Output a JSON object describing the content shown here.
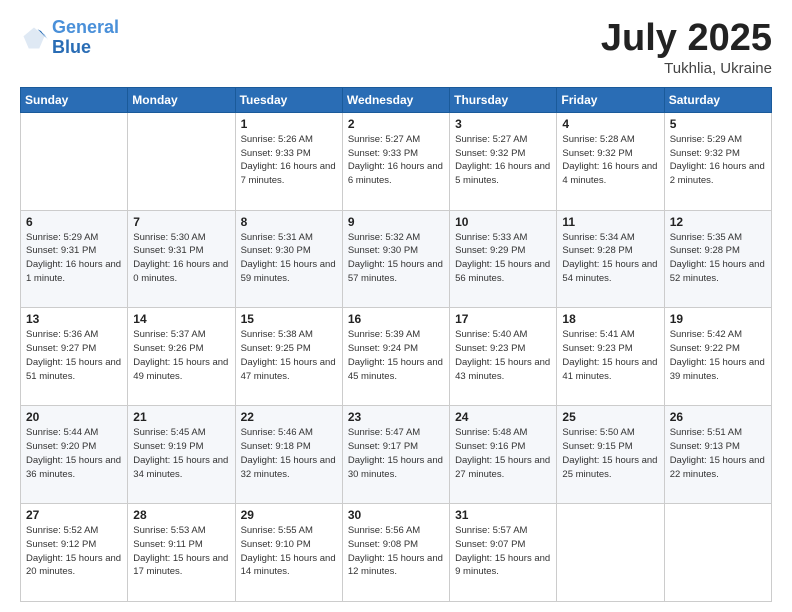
{
  "header": {
    "logo_line1": "General",
    "logo_line2": "Blue",
    "month": "July 2025",
    "location": "Tukhlia, Ukraine"
  },
  "weekdays": [
    "Sunday",
    "Monday",
    "Tuesday",
    "Wednesday",
    "Thursday",
    "Friday",
    "Saturday"
  ],
  "weeks": [
    [
      {
        "day": null
      },
      {
        "day": null
      },
      {
        "day": "1",
        "sunrise": "Sunrise: 5:26 AM",
        "sunset": "Sunset: 9:33 PM",
        "daylight": "Daylight: 16 hours and 7 minutes."
      },
      {
        "day": "2",
        "sunrise": "Sunrise: 5:27 AM",
        "sunset": "Sunset: 9:33 PM",
        "daylight": "Daylight: 16 hours and 6 minutes."
      },
      {
        "day": "3",
        "sunrise": "Sunrise: 5:27 AM",
        "sunset": "Sunset: 9:32 PM",
        "daylight": "Daylight: 16 hours and 5 minutes."
      },
      {
        "day": "4",
        "sunrise": "Sunrise: 5:28 AM",
        "sunset": "Sunset: 9:32 PM",
        "daylight": "Daylight: 16 hours and 4 minutes."
      },
      {
        "day": "5",
        "sunrise": "Sunrise: 5:29 AM",
        "sunset": "Sunset: 9:32 PM",
        "daylight": "Daylight: 16 hours and 2 minutes."
      }
    ],
    [
      {
        "day": "6",
        "sunrise": "Sunrise: 5:29 AM",
        "sunset": "Sunset: 9:31 PM",
        "daylight": "Daylight: 16 hours and 1 minute."
      },
      {
        "day": "7",
        "sunrise": "Sunrise: 5:30 AM",
        "sunset": "Sunset: 9:31 PM",
        "daylight": "Daylight: 16 hours and 0 minutes."
      },
      {
        "day": "8",
        "sunrise": "Sunrise: 5:31 AM",
        "sunset": "Sunset: 9:30 PM",
        "daylight": "Daylight: 15 hours and 59 minutes."
      },
      {
        "day": "9",
        "sunrise": "Sunrise: 5:32 AM",
        "sunset": "Sunset: 9:30 PM",
        "daylight": "Daylight: 15 hours and 57 minutes."
      },
      {
        "day": "10",
        "sunrise": "Sunrise: 5:33 AM",
        "sunset": "Sunset: 9:29 PM",
        "daylight": "Daylight: 15 hours and 56 minutes."
      },
      {
        "day": "11",
        "sunrise": "Sunrise: 5:34 AM",
        "sunset": "Sunset: 9:28 PM",
        "daylight": "Daylight: 15 hours and 54 minutes."
      },
      {
        "day": "12",
        "sunrise": "Sunrise: 5:35 AM",
        "sunset": "Sunset: 9:28 PM",
        "daylight": "Daylight: 15 hours and 52 minutes."
      }
    ],
    [
      {
        "day": "13",
        "sunrise": "Sunrise: 5:36 AM",
        "sunset": "Sunset: 9:27 PM",
        "daylight": "Daylight: 15 hours and 51 minutes."
      },
      {
        "day": "14",
        "sunrise": "Sunrise: 5:37 AM",
        "sunset": "Sunset: 9:26 PM",
        "daylight": "Daylight: 15 hours and 49 minutes."
      },
      {
        "day": "15",
        "sunrise": "Sunrise: 5:38 AM",
        "sunset": "Sunset: 9:25 PM",
        "daylight": "Daylight: 15 hours and 47 minutes."
      },
      {
        "day": "16",
        "sunrise": "Sunrise: 5:39 AM",
        "sunset": "Sunset: 9:24 PM",
        "daylight": "Daylight: 15 hours and 45 minutes."
      },
      {
        "day": "17",
        "sunrise": "Sunrise: 5:40 AM",
        "sunset": "Sunset: 9:23 PM",
        "daylight": "Daylight: 15 hours and 43 minutes."
      },
      {
        "day": "18",
        "sunrise": "Sunrise: 5:41 AM",
        "sunset": "Sunset: 9:23 PM",
        "daylight": "Daylight: 15 hours and 41 minutes."
      },
      {
        "day": "19",
        "sunrise": "Sunrise: 5:42 AM",
        "sunset": "Sunset: 9:22 PM",
        "daylight": "Daylight: 15 hours and 39 minutes."
      }
    ],
    [
      {
        "day": "20",
        "sunrise": "Sunrise: 5:44 AM",
        "sunset": "Sunset: 9:20 PM",
        "daylight": "Daylight: 15 hours and 36 minutes."
      },
      {
        "day": "21",
        "sunrise": "Sunrise: 5:45 AM",
        "sunset": "Sunset: 9:19 PM",
        "daylight": "Daylight: 15 hours and 34 minutes."
      },
      {
        "day": "22",
        "sunrise": "Sunrise: 5:46 AM",
        "sunset": "Sunset: 9:18 PM",
        "daylight": "Daylight: 15 hours and 32 minutes."
      },
      {
        "day": "23",
        "sunrise": "Sunrise: 5:47 AM",
        "sunset": "Sunset: 9:17 PM",
        "daylight": "Daylight: 15 hours and 30 minutes."
      },
      {
        "day": "24",
        "sunrise": "Sunrise: 5:48 AM",
        "sunset": "Sunset: 9:16 PM",
        "daylight": "Daylight: 15 hours and 27 minutes."
      },
      {
        "day": "25",
        "sunrise": "Sunrise: 5:50 AM",
        "sunset": "Sunset: 9:15 PM",
        "daylight": "Daylight: 15 hours and 25 minutes."
      },
      {
        "day": "26",
        "sunrise": "Sunrise: 5:51 AM",
        "sunset": "Sunset: 9:13 PM",
        "daylight": "Daylight: 15 hours and 22 minutes."
      }
    ],
    [
      {
        "day": "27",
        "sunrise": "Sunrise: 5:52 AM",
        "sunset": "Sunset: 9:12 PM",
        "daylight": "Daylight: 15 hours and 20 minutes."
      },
      {
        "day": "28",
        "sunrise": "Sunrise: 5:53 AM",
        "sunset": "Sunset: 9:11 PM",
        "daylight": "Daylight: 15 hours and 17 minutes."
      },
      {
        "day": "29",
        "sunrise": "Sunrise: 5:55 AM",
        "sunset": "Sunset: 9:10 PM",
        "daylight": "Daylight: 15 hours and 14 minutes."
      },
      {
        "day": "30",
        "sunrise": "Sunrise: 5:56 AM",
        "sunset": "Sunset: 9:08 PM",
        "daylight": "Daylight: 15 hours and 12 minutes."
      },
      {
        "day": "31",
        "sunrise": "Sunrise: 5:57 AM",
        "sunset": "Sunset: 9:07 PM",
        "daylight": "Daylight: 15 hours and 9 minutes."
      },
      {
        "day": null
      },
      {
        "day": null
      }
    ]
  ]
}
